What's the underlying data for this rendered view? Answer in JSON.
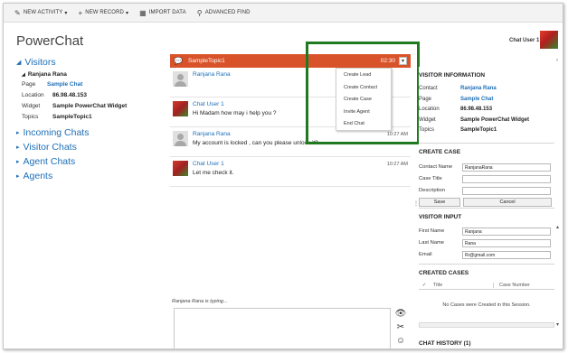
{
  "commandbar": {
    "items": [
      {
        "icon": "edit-icon",
        "glyph": "✎",
        "label": "NEW ACTIVITY",
        "caret": "▾"
      },
      {
        "icon": "plus-icon",
        "glyph": "+",
        "label": "NEW RECORD",
        "caret": "▾"
      },
      {
        "icon": "import-icon",
        "glyph": "▦",
        "label": "IMPORT DATA"
      },
      {
        "icon": "advanced-find-icon",
        "glyph": "⚲",
        "label": "ADVANCED FIND"
      }
    ]
  },
  "app": {
    "title": "PowerChat"
  },
  "user": {
    "name": "Chat User 1"
  },
  "nav": {
    "visitors_label": "Visitors",
    "visitor": {
      "name": "Ranjana Rana",
      "page_label": "Page",
      "page": "Sample Chat",
      "location_label": "Location",
      "location": "86.98.48.153",
      "widget_label": "Widget",
      "widget": "Sample PowerChat Widget",
      "topics_label": "Topics",
      "topics": "SampleTopic1"
    },
    "incoming_label": "Incoming Chats",
    "visitor_chats_label": "Visitor Chats",
    "agent_chats_label": "Agent Chats",
    "agents_label": "Agents"
  },
  "chat": {
    "topic": "SampleTopic1",
    "time": "02:30",
    "messages": [
      {
        "who": "Ranjana Rana",
        "text": "",
        "time": "",
        "avatar": "grey"
      },
      {
        "who": "Chat User 1",
        "text": "Hi Madam how may i help you ?",
        "time": "",
        "avatar": "photo"
      },
      {
        "who": "Ranjana Rana",
        "text": "My account is locked , can you please unlock it?",
        "time": "10:27 AM",
        "avatar": "grey"
      },
      {
        "who": "Chat User 1",
        "text": "Let me check it.",
        "time": "10:27 AM",
        "avatar": "photo"
      }
    ],
    "typing": "Ranjana Rana is typing...",
    "menu": [
      "Create Lead",
      "Create Contact",
      "Create Case",
      "Invite Agent",
      "End Chat"
    ]
  },
  "right": {
    "visitor_info_title": "VISITOR INFORMATION",
    "info": {
      "contact_label": "Contact",
      "contact": "Ranjana Rana",
      "page_label": "Page",
      "page": "Sample Chat",
      "location_label": "Location",
      "location": "86.98.48.153",
      "widget_label": "Widget",
      "widget": "Sample PowerChat Widget",
      "topics_label": "Topics",
      "topics": "SampleTopic1"
    },
    "create_case_title": "CREATE CASE",
    "case": {
      "contact_name_label": "Contact Name",
      "contact_name": "RanjanaRana",
      "case_title_label": "Case Title",
      "case_title": "",
      "description_label": "Description",
      "description": "",
      "save_label": "Save",
      "cancel_label": "Cancel"
    },
    "visitor_input_title": "VISITOR INPUT",
    "input": {
      "first_name_label": "First Name",
      "first_name": "Ranjana",
      "last_name_label": "Last Name",
      "last_name": "Rana",
      "email_label": "Email",
      "email": "Rr@gmail.com"
    },
    "created_cases_title": "CREATED CASES",
    "table": {
      "check": "✓",
      "col_title": "Title",
      "col_case_number": "Case Number",
      "empty": "No Cases were Created in this Session."
    },
    "chat_history_title": "CHAT HISTORY (1)"
  },
  "colors": {
    "accent": "#1e6fb7",
    "chat_header": "#d9532a",
    "highlight": "#1f7a1f"
  }
}
